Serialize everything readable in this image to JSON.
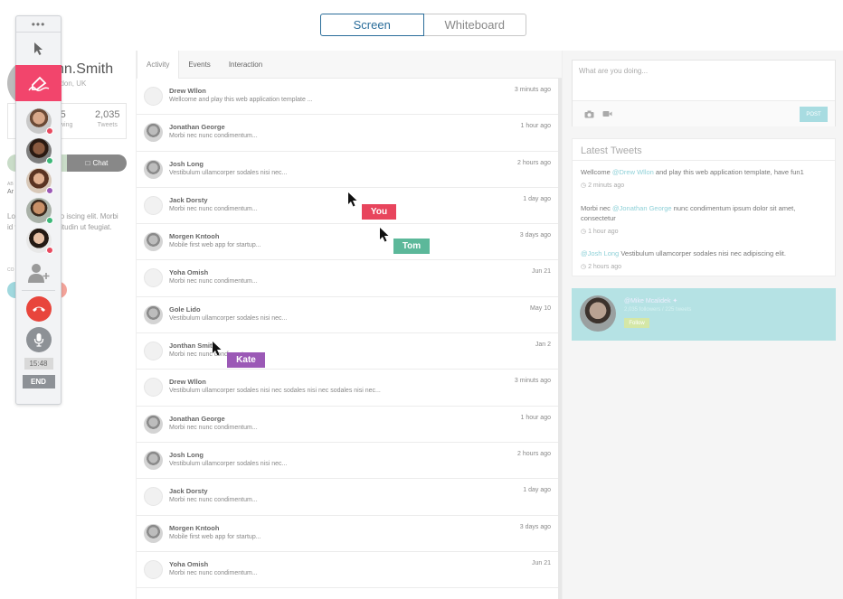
{
  "view_toggle": {
    "screen": "Screen",
    "whiteboard": "Whiteboard",
    "active": "Screen"
  },
  "profile": {
    "name": "hn.Smith",
    "location": "ndon, UK",
    "stats": [
      {
        "num": "5",
        "label": "llowing"
      },
      {
        "num": "2,035",
        "label": "Tweets"
      }
    ],
    "chat_label": "Chat",
    "about_heading": "AB",
    "about_value": "Ar",
    "intro": "Lo lor sit amet, co iscing elit. Morbi id ve quam sollicitudin ut feugiat.",
    "connect_heading": "CO"
  },
  "toolbar": {
    "menu_glyph": "•••",
    "timer": "15:48",
    "end_label": "END",
    "participants": [
      {
        "status_color": "#e84a5f"
      },
      {
        "status_color": "#3cb878"
      },
      {
        "status_color": "#9b59b6"
      },
      {
        "status_color": "#3cb878"
      },
      {
        "status_color": "#e84a5f"
      }
    ],
    "pen_color": "#f2456c",
    "hangup_color": "#e8453c",
    "mic_color": "#8d9196"
  },
  "feed": {
    "tabs": [
      "Activity",
      "Events",
      "Interaction"
    ],
    "active_tab": "Activity",
    "items": [
      {
        "name": "Drew Wllon",
        "text": "Wellcome and play this web application template ...",
        "time": "3 minuts ago",
        "avatar": "none"
      },
      {
        "name": "Jonathan George",
        "text": "Morbi nec nunc condimentum...",
        "time": "1 hour ago",
        "avatar": "photo"
      },
      {
        "name": "Josh Long",
        "text": "Vestibulum ullamcorper sodales nisi nec...",
        "time": "2 hours ago",
        "avatar": "photo"
      },
      {
        "name": "Jack Dorsty",
        "text": "Morbi nec nunc condimentum...",
        "time": "1 day ago",
        "avatar": "none"
      },
      {
        "name": "Morgen Kntooh",
        "text": "Mobile first web app for startup...",
        "time": "3 days ago",
        "avatar": "photo"
      },
      {
        "name": "Yoha Omish",
        "text": "Morbi nec nunc condimentum...",
        "time": "Jun 21",
        "avatar": "none"
      },
      {
        "name": "Gole Lido",
        "text": "Vestibulum ullamcorper sodales nisi nec...",
        "time": "May 10",
        "avatar": "photo"
      },
      {
        "name": "Jonthan Smith",
        "text": "Morbi nec nunc condimentum...",
        "time": "Jan 2",
        "avatar": "none"
      },
      {
        "name": "Drew Wllon",
        "text": "Vestibulum ullamcorper sodales nisi nec sodales nisi nec sodales nisi nec...",
        "time": "3 minuts ago",
        "avatar": "none"
      },
      {
        "name": "Jonathan George",
        "text": "Morbi nec nunc condimentum...",
        "time": "1 hour ago",
        "avatar": "photo"
      },
      {
        "name": "Josh Long",
        "text": "Vestibulum ullamcorper sodales nisi nec...",
        "time": "2 hours ago",
        "avatar": "photo"
      },
      {
        "name": "Jack Dorsty",
        "text": "Morbi nec nunc condimentum...",
        "time": "1 day ago",
        "avatar": "none"
      },
      {
        "name": "Morgen Kntooh",
        "text": "Mobile first web app for startup...",
        "time": "3 days ago",
        "avatar": "photo"
      },
      {
        "name": "Yoha Omish",
        "text": "Morbi nec nunc condimentum...",
        "time": "Jun 21",
        "avatar": "none"
      }
    ]
  },
  "cursors": [
    {
      "label": "You",
      "color": "#e8455d"
    },
    {
      "label": "Tom",
      "color": "#5cb89a"
    },
    {
      "label": "Kate",
      "color": "#9b59b6"
    }
  ],
  "compose": {
    "placeholder": "What are you doing...",
    "post_label": "POST"
  },
  "latest_tweets": {
    "title": "Latest Tweets",
    "items": [
      {
        "pre": "Wellcome ",
        "mention": "@Drew Wllon",
        "post": " and play this web application template, have fun1",
        "time": "2 minuts ago"
      },
      {
        "pre": "Morbi nec ",
        "mention": "@Jonathan George",
        "post": " nunc condimentum ipsum dolor sit amet, consectetur",
        "time": "1 hour ago"
      },
      {
        "pre": "",
        "mention": "@Josh Long",
        "post": " Vestibulum ullamcorper sodales nisi nec adipiscing elit.",
        "time": "2 hours ago"
      }
    ]
  },
  "profile_card": {
    "handle": "@Mike Mcalidek",
    "stats": "2,035 followers / 225 tweets",
    "follow_label": "Follow"
  },
  "colors": {
    "accent": "#2a6d9a",
    "teal": "#a8dce1",
    "pink": "#f2456c"
  }
}
